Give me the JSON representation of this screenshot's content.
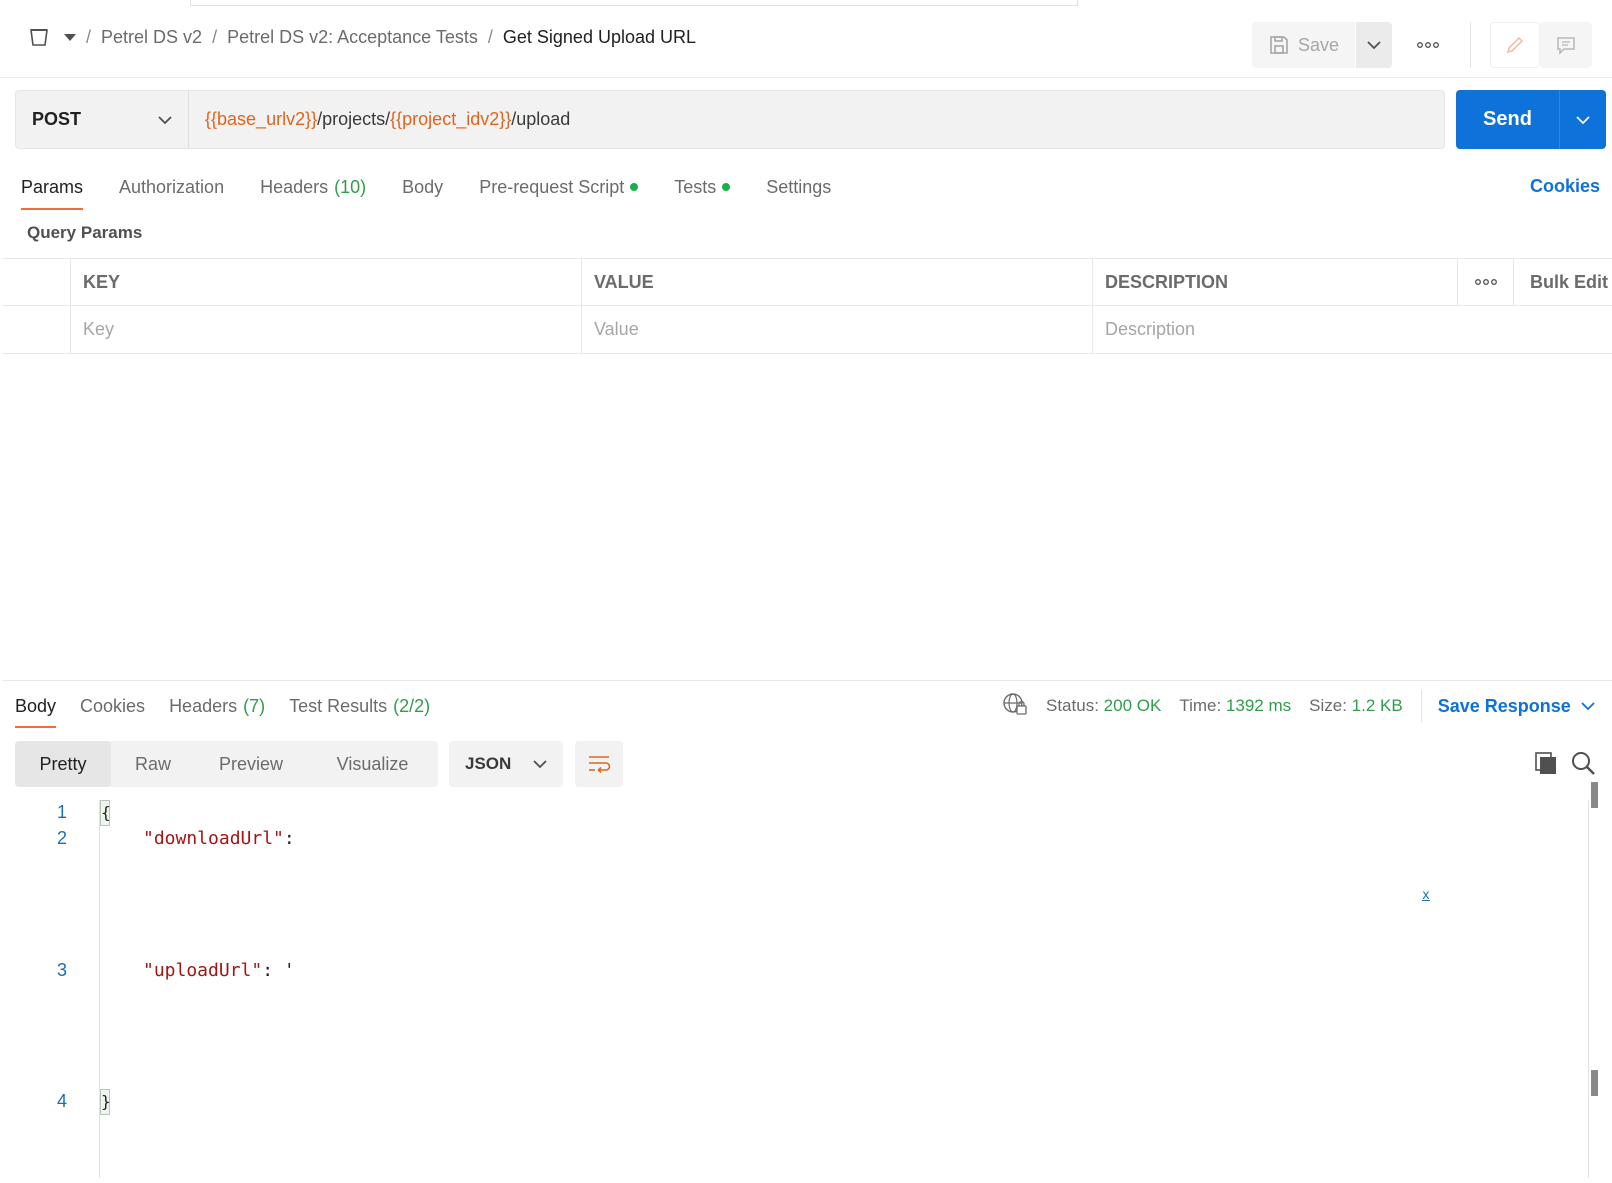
{
  "breadcrumb": {
    "items": [
      "Petrel DS v2",
      "Petrel DS v2: Acceptance Tests"
    ],
    "current": "Get Signed Upload URL",
    "separator": "/"
  },
  "header_actions": {
    "save_label": "Save",
    "more_icon": "ellipsis-icon",
    "edit_icon": "pencil-icon",
    "comment_icon": "comment-icon"
  },
  "request": {
    "method": "POST",
    "url_parts": [
      {
        "text": "{{base_urlv2}}",
        "var": true
      },
      {
        "text": "/projects/",
        "var": false
      },
      {
        "text": "{{project_idv2}}",
        "var": true
      },
      {
        "text": "/upload",
        "var": false
      }
    ],
    "send_label": "Send"
  },
  "request_tabs": [
    {
      "label": "Params",
      "count": "",
      "dot": false,
      "active": true
    },
    {
      "label": "Authorization",
      "count": "",
      "dot": false,
      "active": false
    },
    {
      "label": "Headers",
      "count": "(10)",
      "dot": false,
      "active": false
    },
    {
      "label": "Body",
      "count": "",
      "dot": false,
      "active": false
    },
    {
      "label": "Pre-request Script",
      "count": "",
      "dot": true,
      "active": false
    },
    {
      "label": "Tests",
      "count": "",
      "dot": true,
      "active": false
    },
    {
      "label": "Settings",
      "count": "",
      "dot": false,
      "active": false
    }
  ],
  "cookies_link": "Cookies",
  "query_params": {
    "title": "Query Params",
    "headers": {
      "key": "KEY",
      "value": "VALUE",
      "description": "DESCRIPTION",
      "bulk_edit": "Bulk Edit"
    },
    "placeholders": {
      "key": "Key",
      "value": "Value",
      "description": "Description"
    }
  },
  "response_tabs": [
    {
      "label": "Body",
      "count": "",
      "active": true
    },
    {
      "label": "Cookies",
      "count": "",
      "active": false
    },
    {
      "label": "Headers",
      "count": "(7)",
      "active": false
    },
    {
      "label": "Test Results",
      "count": "(2/2)",
      "active": false
    }
  ],
  "response_meta": {
    "status_label": "Status:",
    "status_value": "200 OK",
    "time_label": "Time:",
    "time_value": "1392 ms",
    "size_label": "Size:",
    "size_value": "1.2 KB",
    "save_response": "Save Response"
  },
  "view_modes": [
    "Pretty",
    "Raw",
    "Preview",
    "Visualize"
  ],
  "active_view": "Pretty",
  "format": "JSON",
  "code": {
    "lines": [
      {
        "num": "1",
        "text": "{"
      },
      {
        "num": "2",
        "key": "\"downloadUrl\"",
        "rest": ":"
      },
      {
        "num": "3",
        "key": "\"uploadUrl\"",
        "rest": ": '"
      },
      {
        "num": "4",
        "text": "}"
      }
    ],
    "marker": "x"
  },
  "colors": {
    "accent": "#0d72d9",
    "tab_active": "#f26b3a",
    "variable": "#e0641f",
    "success": "#2e9e4b",
    "json_key": "#a31515"
  }
}
